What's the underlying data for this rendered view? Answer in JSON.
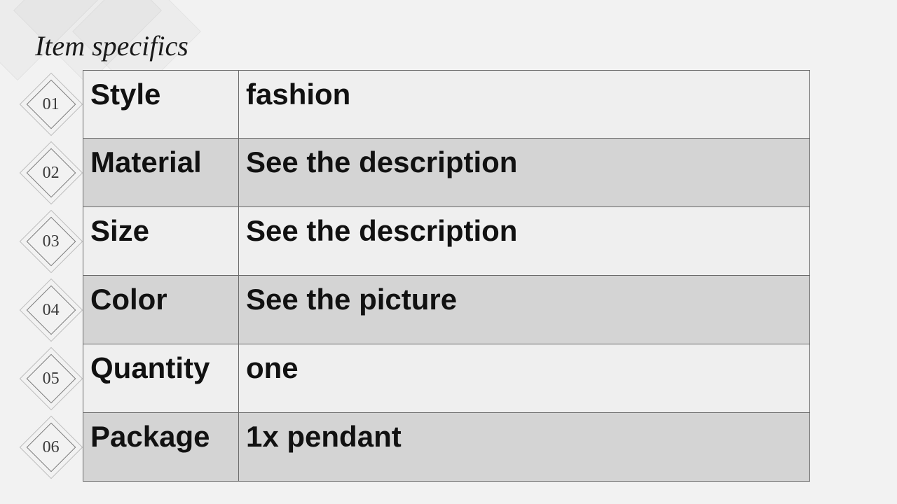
{
  "title": "Item specifics",
  "rows": [
    {
      "num": "01",
      "label": "Style",
      "value": "fashion",
      "shade": "light"
    },
    {
      "num": "02",
      "label": "Material",
      "value": "See the description",
      "shade": "dark"
    },
    {
      "num": "03",
      "label": "Size",
      "value": "See the description",
      "shade": "light"
    },
    {
      "num": "04",
      "label": "Color",
      "value": "See the picture",
      "shade": "dark"
    },
    {
      "num": "05",
      "label": "Quantity",
      "value": "one",
      "shade": "light"
    },
    {
      "num": "06",
      "label": "Package",
      "value": "1x pendant",
      "shade": "dark"
    }
  ]
}
